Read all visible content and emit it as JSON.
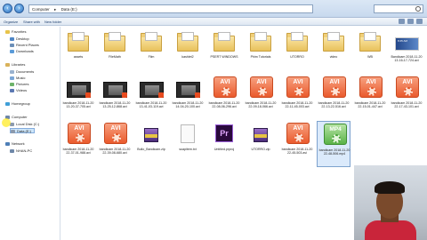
{
  "address": {
    "parts": [
      "Computer",
      "Data (E:)"
    ]
  },
  "search": {
    "placeholder": ""
  },
  "toolbar": {
    "organize": "Organize",
    "share": "Share with",
    "new_folder": "New folder"
  },
  "sidebar": {
    "items": [
      {
        "label": "Favorites"
      },
      {
        "label": "Desktop"
      },
      {
        "label": "Recent Places"
      },
      {
        "label": "Downloads"
      },
      {
        "label": "Libraries"
      },
      {
        "label": "Documents"
      },
      {
        "label": "Music"
      },
      {
        "label": "Pictures"
      },
      {
        "label": "Videos"
      },
      {
        "label": "Homegroup"
      },
      {
        "label": "Computer"
      },
      {
        "label": "Local Disk (C:)"
      },
      {
        "label": "Data (E:)"
      },
      {
        "label": "Network"
      },
      {
        "label": "NHAN-PC"
      }
    ]
  },
  "files": [
    {
      "kind": "folder",
      "name": "assets"
    },
    {
      "kind": "folder",
      "name": "FileMath"
    },
    {
      "kind": "folder",
      "name": "Film"
    },
    {
      "kind": "folder",
      "name": "kashlet2"
    },
    {
      "kind": "folder",
      "name": "PSERT WINDOWS"
    },
    {
      "kind": "folder",
      "name": "Phim Tutorials"
    },
    {
      "kind": "folder",
      "name": "UTORRO"
    },
    {
      "kind": "folder",
      "name": "video"
    },
    {
      "kind": "folder",
      "name": "WB"
    },
    {
      "kind": "image",
      "name": "Bandicam 2018-11-20 13-16-17-724.avi",
      "text": "8:45 AM"
    },
    {
      "kind": "film",
      "name": "bandicam 2018-11-20 13-20-37-705.avi"
    },
    {
      "kind": "film",
      "name": "bandicam 2018-11-20 13-25-12-868.avi"
    },
    {
      "kind": "film",
      "name": "bandicam 2018-11-20 13-41-03-119.avi"
    },
    {
      "kind": "film",
      "name": "bandicam 2018-11-20 14-04-20-100.avi"
    },
    {
      "kind": "avi",
      "name": "bandicam 2018-11-20 22-08-06-296.avi"
    },
    {
      "kind": "avi",
      "name": "bandicam 2018-11-20 22-09-18-066.avi"
    },
    {
      "kind": "avi",
      "name": "bandicam 2018-11-20 22-11-45-003.avi"
    },
    {
      "kind": "avi",
      "name": "bandicam 2018-11-20 22-13-22-516.avi"
    },
    {
      "kind": "avi",
      "name": "bandicam 2018-11-20 22-15-01-447.avi"
    },
    {
      "kind": "avi",
      "name": "bandicam 2018-11-20 22-17-43-101.avi"
    },
    {
      "kind": "avi",
      "name": "bandicam 2018-11-20 22-37-01-988.avi"
    },
    {
      "kind": "avi",
      "name": "bandicam 2018-11-20 22-39-08-680.avi"
    },
    {
      "kind": "rar",
      "name": "Bullo_Bandicam.zip"
    },
    {
      "kind": "doc",
      "name": "soapitem.txt"
    },
    {
      "kind": "prem",
      "name": "Untitled.prproj"
    },
    {
      "kind": "rar",
      "name": "UTORRO.zip"
    },
    {
      "kind": "avi",
      "name": "bandicam 2018-11-20 22-45-503.avi"
    },
    {
      "kind": "mp4",
      "name": "bandicam 2018-11-20 22-48-506.mp4",
      "selected": true
    }
  ],
  "icons": {
    "avi_label": "AVI",
    "mp4_label": "MP4",
    "prem_label": "Pr"
  },
  "colors": {
    "avi": "#ea5a2d",
    "mp4": "#5ab348",
    "selection": "#dbeafb"
  }
}
